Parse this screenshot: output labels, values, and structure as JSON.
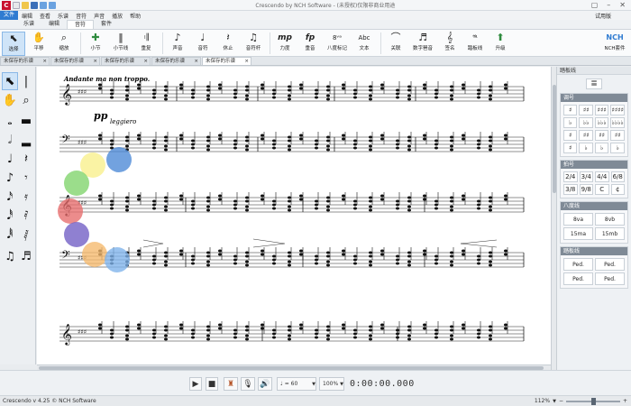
{
  "app": {
    "logo": "C",
    "title": "Crescendo by NCH Software - (未授权)仅限非商业用途",
    "help_label": "试用版"
  },
  "menu": [
    "文件",
    "编辑",
    "查看",
    "乐谱",
    "音符",
    "声音",
    "播放",
    "帮助"
  ],
  "ribbon_tabs": [
    "乐谱",
    "编辑",
    "音符",
    "套件"
  ],
  "ribbon_active_tab": "音符",
  "ribbon_buttons": [
    {
      "label": "选择",
      "icon": "pointer-icon"
    },
    {
      "label": "平移",
      "icon": "hand-icon"
    },
    {
      "label": "缩放",
      "icon": "magnifier-icon"
    },
    {
      "label": "小节",
      "icon": "measure-icon"
    },
    {
      "label": "小节线",
      "icon": "barline-icon"
    },
    {
      "label": "重复",
      "icon": "repeat-icon"
    },
    {
      "label": "声音",
      "icon": "voice-icon"
    },
    {
      "label": "音符",
      "icon": "note-icon"
    },
    {
      "label": "休止",
      "icon": "rest-icon"
    },
    {
      "label": "音符杆",
      "icon": "stem-icon"
    },
    {
      "label": "力度",
      "icon": "dynamics-icon"
    },
    {
      "label": "重音",
      "icon": "accent-icon"
    },
    {
      "label": "八度标记",
      "icon": "octave-icon"
    },
    {
      "label": "文本",
      "icon": "text-icon"
    },
    {
      "label": "关联",
      "icon": "tie-icon"
    },
    {
      "label": "数字琶音",
      "icon": "arpeggio-icon"
    },
    {
      "label": "签名",
      "icon": "signature-icon"
    },
    {
      "label": "踏板线",
      "icon": "pedal-icon"
    },
    {
      "label": "升级",
      "icon": "upgrade-icon"
    }
  ],
  "nch_label": "NCH套件",
  "doc_tabs": [
    "未保存的乐谱",
    "未保存的乐谱",
    "未保存的乐谱",
    "未保存的乐谱",
    "未保存的乐谱"
  ],
  "doc_tab_close": "×",
  "score": {
    "tempo_marking": "Andante ma non troppo.",
    "dynamic": "pp",
    "expression": "leggiero",
    "ottava": "----"
  },
  "right_panel": {
    "header": "踏板线",
    "sections": [
      {
        "title": "调号",
        "cells": [
          "♯",
          "♯♯",
          "♯♯♯",
          "♯♯♯♯",
          "♭",
          "♭♭",
          "♭♭♭",
          "♭♭♭♭",
          "♯",
          "♯♯",
          "♯♯",
          "♯♯",
          "♯",
          "♭",
          "♭",
          "♭"
        ]
      },
      {
        "title": "拍号",
        "cells": [
          "2/4",
          "3/4",
          "4/4",
          "6/8",
          "3/8",
          "9/8",
          "C",
          "¢"
        ]
      },
      {
        "title": "八度线",
        "cells": [
          "8va",
          "8vb",
          "15ma",
          "15mb"
        ]
      },
      {
        "title": "踏板线",
        "cells": [
          "Ped.",
          "Ped.",
          "Ped.",
          "Ped."
        ]
      }
    ]
  },
  "playback": {
    "tempo": "♩ = 60",
    "volume": "100%",
    "time": "0:00:00.000"
  },
  "status": {
    "text": "Crescendo v 4.25 © NCH Software",
    "zoom": "112%"
  }
}
